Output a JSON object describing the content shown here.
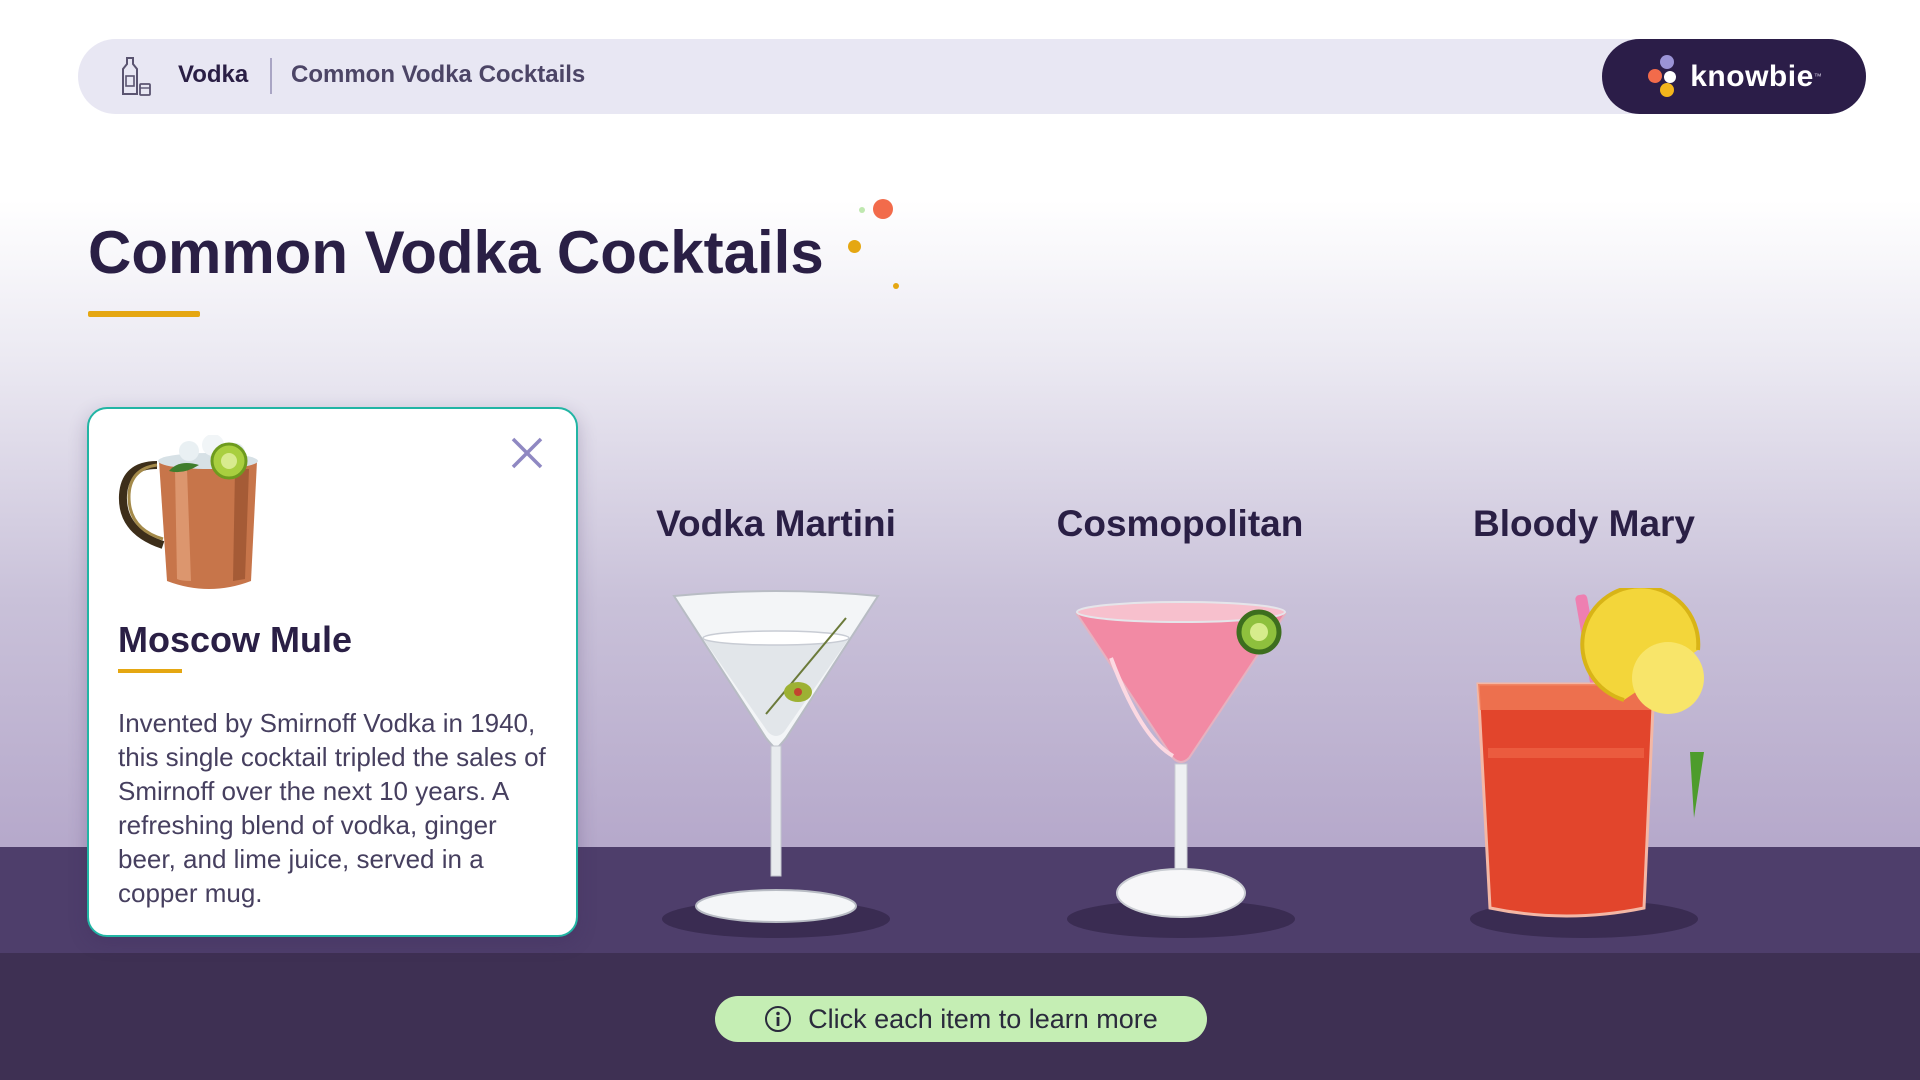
{
  "breadcrumb": {
    "section": "Vodka",
    "page": "Common Vodka Cocktails",
    "icon": "bottle-glass-icon"
  },
  "brand": {
    "name": "knowbie",
    "trademark": "™"
  },
  "page_title": "Common Vodka Cocktails",
  "colors": {
    "accent_underline": "#e5a712",
    "dark_purple": "#2a1f45",
    "shelf": "#4e3e6b",
    "footer": "#3e3053",
    "card_border": "#22b5a4",
    "hint_bg": "#c5eeb4"
  },
  "items": [
    {
      "label": "Moscow Mule",
      "icon": "copper-mug-icon",
      "expanded": true
    },
    {
      "label": "Vodka Martini",
      "icon": "martini-glass-icon",
      "expanded": false
    },
    {
      "label": "Cosmopolitan",
      "icon": "cosmopolitan-glass-icon",
      "expanded": false
    },
    {
      "label": "Bloody Mary",
      "icon": "bloody-mary-glass-icon",
      "expanded": false
    }
  ],
  "card": {
    "title": "Moscow Mule",
    "body": "Invented by Smirnoff Vodka in 1940, this single cocktail tripled the sales of Smirnoff over the next 10 years. A refreshing blend of vodka, ginger beer, and lime juice, served in a copper mug.",
    "close_icon": "close-icon"
  },
  "hint": {
    "text": "Click each item to learn more",
    "icon": "info-icon"
  }
}
